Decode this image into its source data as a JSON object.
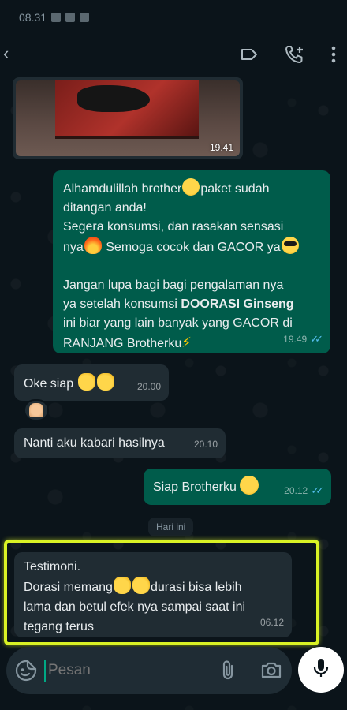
{
  "status_bar": {
    "time": "08.31"
  },
  "messages": [
    {
      "type": "photo",
      "time": "19.41"
    },
    {
      "type": "outgoing",
      "lines": [
        [
          "Alhamdulillah brother",
          "",
          "paket sudah"
        ],
        "ditangan anda!",
        "Segera konsumsi, dan rasakan sensasi",
        [
          "nya",
          " Semoga cocok dan GACOR ya"
        ],
        "",
        "Jangan lupa bagi bagi pengalaman nya",
        [
          "ya setelah konsumsi ",
          "DOORASI Ginseng"
        ],
        "ini biar yang lain banyak yang GACOR di",
        "RANJANG Brotherku"
      ],
      "time": "19.49"
    },
    {
      "type": "incoming",
      "text": "Oke siap",
      "time": "20.00"
    },
    {
      "type": "incoming",
      "text": "Nanti aku kabari hasilnya",
      "time": "20.10"
    },
    {
      "type": "outgoing",
      "text": "Siap Brotherku",
      "time": "20.12"
    },
    {
      "type": "incoming",
      "lines": [
        "Testimoni.",
        "Dorasi memang",
        "durasi bisa lebih",
        "lama dan betul efek nya sampai saat ini",
        "tegang terus"
      ],
      "time": "06.12"
    }
  ],
  "date_divider": "Hari ini",
  "input": {
    "placeholder": "Pesan"
  },
  "colors": {
    "outgoing": "#005c4b",
    "incoming": "#202c33",
    "highlight": "#d9f225",
    "read_ticks": "#53bdeb"
  }
}
